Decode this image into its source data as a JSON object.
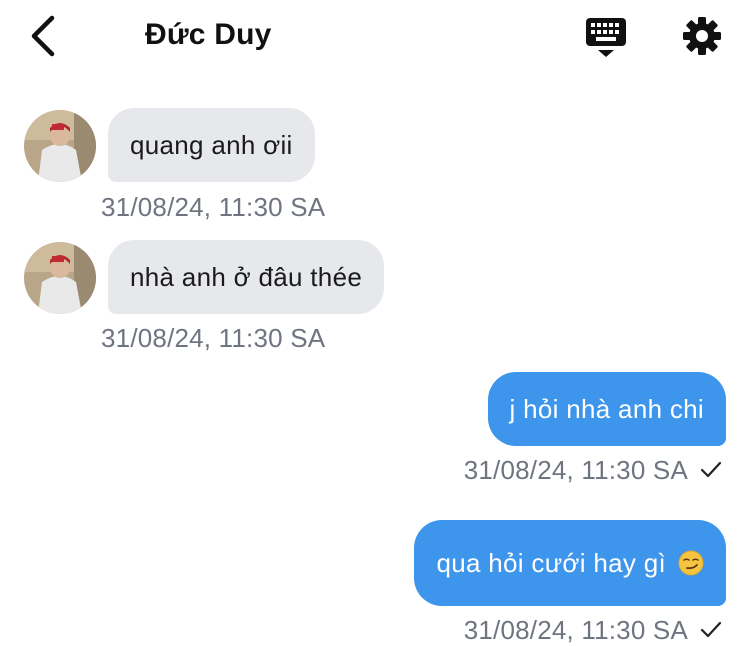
{
  "header": {
    "title": "Đức Duy",
    "back_icon": "chevron-left-icon",
    "keyboard_icon": "keyboard-icon",
    "settings_icon": "gear-icon"
  },
  "messages": [
    {
      "direction": "incoming",
      "text": "quang anh ơii",
      "time": "31/08/24, 11:30 SA"
    },
    {
      "direction": "incoming",
      "text": "nhà anh ở đâu thée",
      "time": "31/08/24, 11:30 SA"
    },
    {
      "direction": "outgoing",
      "text": "j hỏi nhà anh chi",
      "time": "31/08/24, 11:30 SA",
      "status_icon": "check-icon"
    },
    {
      "direction": "outgoing",
      "text": "qua hỏi cưới hay gì",
      "emoji": "smirk-emoji",
      "time": "31/08/24, 11:30 SA",
      "status_icon": "check-icon"
    }
  ],
  "colors": {
    "incoming_bubble": "#e6e8ec",
    "outgoing_bubble": "#3d95ec",
    "timestamp": "#6e7581"
  }
}
